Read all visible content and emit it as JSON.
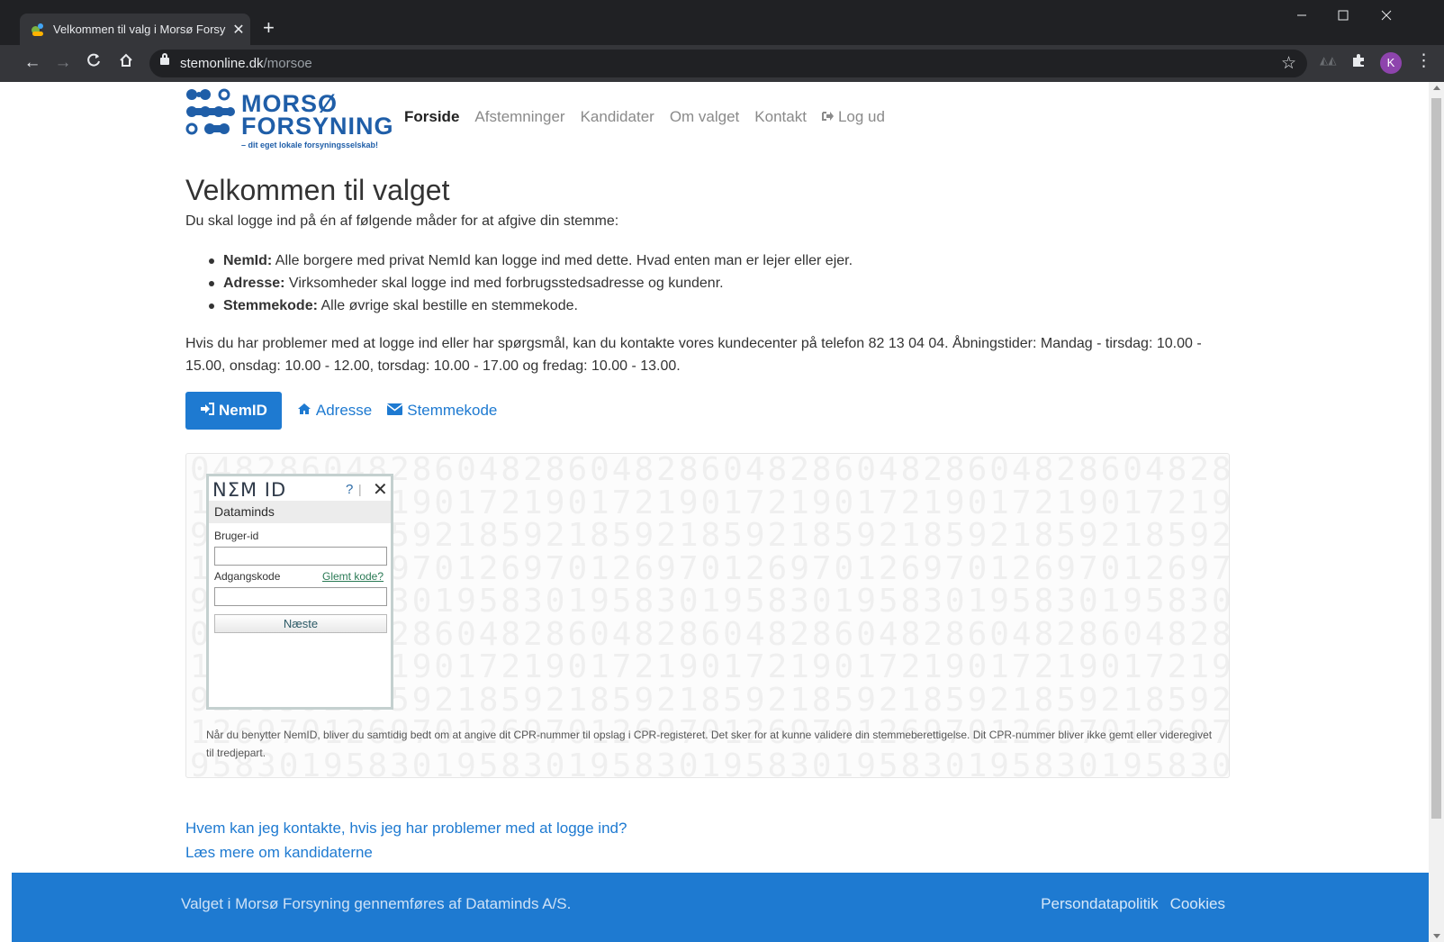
{
  "browser": {
    "tab_title": "Velkommen til valg i Morsø Forsy",
    "tab_close": "✕",
    "new_tab": "+",
    "url_domain": "stemonline.dk",
    "url_path": "/morsoe",
    "profile_initial": "K",
    "icons": [
      "back-icon",
      "forward-icon",
      "reload-icon",
      "home-icon",
      "lock-icon",
      "bookmark-star-icon",
      "extension-icon",
      "puzzle-icon",
      "menu-kebab-icon",
      "minimize-icon",
      "maximize-icon",
      "close-window-icon"
    ]
  },
  "header": {
    "logo_line1": "MORSØ",
    "logo_line2": "FORSYNING",
    "logo_tagline": "– dit eget lokale forsyningsselskab!",
    "logo_color": "#1f5ea8",
    "nav": [
      "Forside",
      "Afstemninger",
      "Kandidater",
      "Om valget",
      "Kontakt",
      "Log ud"
    ],
    "active_nav": "Forside"
  },
  "main": {
    "title": "Velkommen til valget",
    "intro": "Du skal logge ind på én af følgende måder for at afgive din stemme:",
    "methods": [
      {
        "name": "NemId:",
        "text": " Alle borgere med privat NemId kan logge ind med dette. Hvad enten man er lejer eller ejer."
      },
      {
        "name": "Adresse:",
        "text": " Virksomheder skal logge ind med forbrugsstedsadresse og kundenr."
      },
      {
        "name": "Stemmekode:",
        "text": " Alle øvrige skal bestille en stemmekode."
      }
    ],
    "contact_info": "Hvis du har problemer med at logge ind eller har spørgsmål, kan du kontakte vores kundecenter på telefon 82 13 04 04. Åbningstider: Mandag - tirsdag: 10.00 - 15.00, onsdag: 10.00 - 12.00, torsdag: 10.00 - 17.00 og fredag: 10.00 - 13.00.",
    "login_tabs": [
      "NemID",
      "Adresse",
      "Stemmekode"
    ],
    "active_login_tab": "NemID",
    "accent_color": "#1e7ad1"
  },
  "nemid": {
    "logo": "NΣM ID",
    "help": "?",
    "close": "✕",
    "provider": "Dataminds",
    "user_label": "Bruger-id",
    "user_value": "",
    "password_label": "Adgangskode",
    "forgot_link": "Glemt kode?",
    "password_value": "",
    "next_button": "Næste",
    "note": "Når du benytter NemID, bliver du samtidig bedt om at angive dit CPR-nummer til opslag i CPR-registeret. Det sker for at kunne validere din stemmeberettigelse. Dit CPR-nummer bliver ikke gemt eller videregivet til tredjepart."
  },
  "help_links": [
    "Hvem kan jeg kontakte, hvis jeg har problemer med at logge ind?",
    "Læs mere om kandidaterne"
  ],
  "footer": {
    "text": "Valget i Morsø Forsyning gennemføres af Dataminds A/S.",
    "links": [
      "Persondatapolitik",
      "Cookies"
    ],
    "background": "#1e7ad1"
  }
}
